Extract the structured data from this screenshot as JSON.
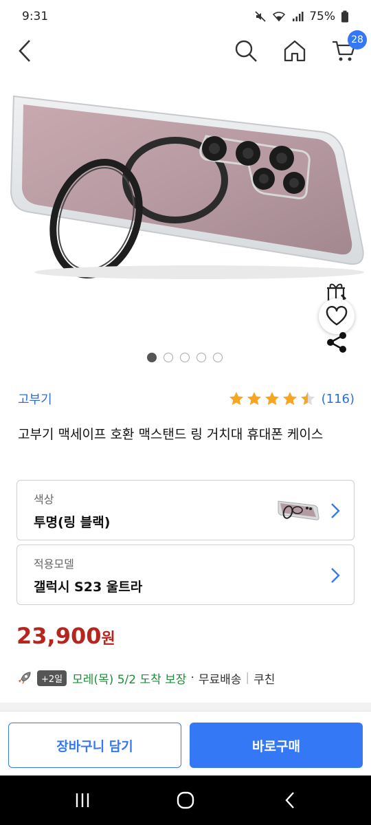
{
  "status_bar": {
    "time": "9:31",
    "battery": "75%"
  },
  "header": {
    "cart_count": "28"
  },
  "product": {
    "brand": "고부기",
    "rating_count": "(116)",
    "rating": 4.5,
    "title": "고부기 맥세이프 호환 맥스탠드 링 거치대 휴대폰 케이스",
    "image_count": 5,
    "active_image": 1
  },
  "options": [
    {
      "label": "색상",
      "value": "투명(링 블랙)"
    },
    {
      "label": "적용모델",
      "value": "갤럭시 S23 울트라"
    }
  ],
  "price": {
    "amount": "23,900",
    "unit": "원"
  },
  "delivery": {
    "badge": "+2일",
    "arrival": "모레(목) 5/2 도착 보장",
    "dot": "·",
    "free_shipping": "무료배송",
    "separator": "|",
    "courier": "쿠친"
  },
  "actions": {
    "cart_label": "장바구니 담기",
    "buy_label": "바로구매"
  },
  "colors": {
    "accent": "#3478f6",
    "price": "#b5261e",
    "star": "#f5a623",
    "arrival": "#1f8c3a"
  }
}
